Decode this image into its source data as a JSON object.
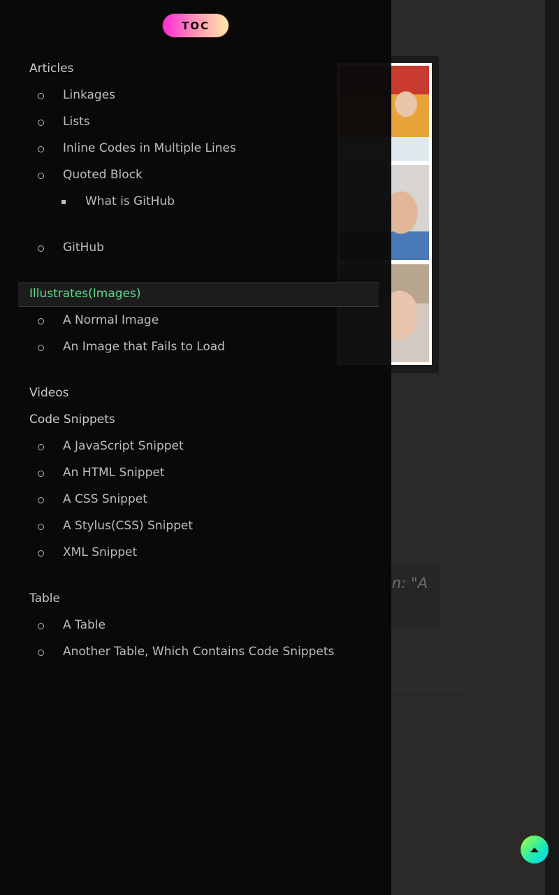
{
  "toc": {
    "button_label": "TOC",
    "items": [
      {
        "label": "Articles"
      },
      {
        "label": "Linkages"
      },
      {
        "label": "Lists"
      },
      {
        "label": "Inline Codes in Multiple Lines"
      },
      {
        "label": "Quoted Block"
      },
      {
        "label": "What is GitHub"
      },
      {
        "label": "GitHub"
      },
      {
        "label": "Illustrates(Images)"
      },
      {
        "label": "A Normal Image"
      },
      {
        "label": "An Image that Fails to Load"
      },
      {
        "label": "Videos"
      },
      {
        "label": "Code Snippets"
      },
      {
        "label": "A JavaScript Snippet"
      },
      {
        "label": "An HTML Snippet"
      },
      {
        "label": "A CSS Snippet"
      },
      {
        "label": "A Stylus(CSS) Snippet"
      },
      {
        "label": "XML Snippet"
      },
      {
        "label": "Table"
      },
      {
        "label": "A Table"
      },
      {
        "label": "Another Table, Which Contains Code Snippets"
      }
    ],
    "active_color": "#5fd98a"
  },
  "article": {
    "quote_fragment": "on: \"A"
  },
  "controls": {
    "back_to_top_icon": "caret-up-icon"
  }
}
